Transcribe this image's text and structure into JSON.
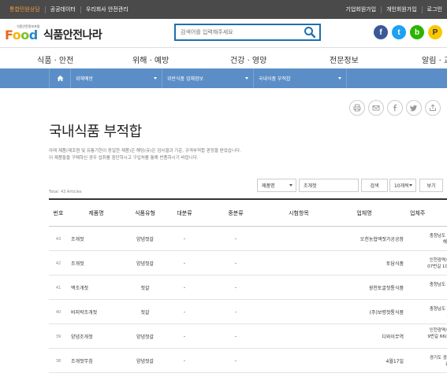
{
  "topbar": {
    "left_items": [
      "통합민원상담",
      "공공데이터",
      "우리회사 안전관리"
    ],
    "right_items": [
      "기업회원가입",
      "개인회원가입",
      "로그인"
    ]
  },
  "header": {
    "logo_tagline": "식품안전정보포털",
    "logo_word": {
      "f": "F",
      "o1": "o",
      "o2": "o",
      "d": "d"
    },
    "logo_text": "식품안전나라",
    "search_placeholder": "검색어를 입력해주세요",
    "social": [
      {
        "name": "facebook-icon",
        "glyph": "f",
        "color": "#3b5998"
      },
      {
        "name": "twitter-icon",
        "glyph": "t",
        "color": "#1da1f2"
      },
      {
        "name": "blog-icon",
        "glyph": "b",
        "color": "#2db400"
      },
      {
        "name": "kakao-icon",
        "glyph": "P",
        "color": "#f9c800"
      }
    ]
  },
  "gnb": [
    "식품 · 안전",
    "위해 · 예방",
    "건강 · 영양",
    "전문정보",
    "알림 · 교"
  ],
  "breadcrumb": [
    "위해예방",
    "위반식품 업체정보",
    "국내식품 부적합"
  ],
  "page": {
    "title": "국내식품 부적합",
    "desc_line1": "아래 제품(제조원 및 유통기한이 동일한 제품)은 해당(유)은 검사결과 기준, 규격부적합 판정을 받았습니다.",
    "desc_line2": "이 제품들을 구매하신 경우 섭취를 중단하시고 구입처를 통해 반품하시기 바랍니다."
  },
  "filter": {
    "field_select": "제품명",
    "keyword": "조개젓",
    "search_button": "검색",
    "page_size": "10개씩",
    "view_button": "보기"
  },
  "total_label": "Total: 43 Articles",
  "table": {
    "headers": [
      "번호",
      "제품명",
      "식품유형",
      "대분류",
      "중분류",
      "시험항목",
      "업체명",
      "업체주"
    ],
    "rows": [
      {
        "no": "43",
        "product": "조개젓",
        "type": "양념젓갈",
        "cat1": "-",
        "cat2": "-",
        "test": "",
        "company": "오천농협액젓가공공장",
        "addr": "충청남도 보령\n해안로"
      },
      {
        "no": "42",
        "product": "조개젓",
        "type": "양념젓갈",
        "cat1": "-",
        "cat2": "-",
        "test": "",
        "company": "토담식품",
        "addr": "인천광역시 중\n07번길 10-15"
      },
      {
        "no": "41",
        "product": "백조개젓",
        "type": "젓갈",
        "cat1": "-",
        "cat2": "-",
        "test": "",
        "company": "광천토굴젓통식품",
        "addr": "충청남도 홍성\n새우"
      },
      {
        "no": "40",
        "product": "바지락조개젓",
        "type": "젓갈",
        "cat1": "-",
        "cat2": "-",
        "test": "",
        "company": "(주)보령젓통식품",
        "addr": "충청남도 보령\n3(신"
      },
      {
        "no": "39",
        "product": "양념조개젓",
        "type": "양념젓갈",
        "cat1": "-",
        "cat2": "-",
        "test": "",
        "company": "디와이무역",
        "addr": "인천광역시 중\n9번길 66(가동\n7"
      },
      {
        "no": "38",
        "product": "조개젓무침",
        "type": "양념젓갈",
        "cat1": "-",
        "cat2": "-",
        "test": "",
        "company": "4월17일",
        "addr": "경기도 광명시\n층 노"
      }
    ]
  }
}
